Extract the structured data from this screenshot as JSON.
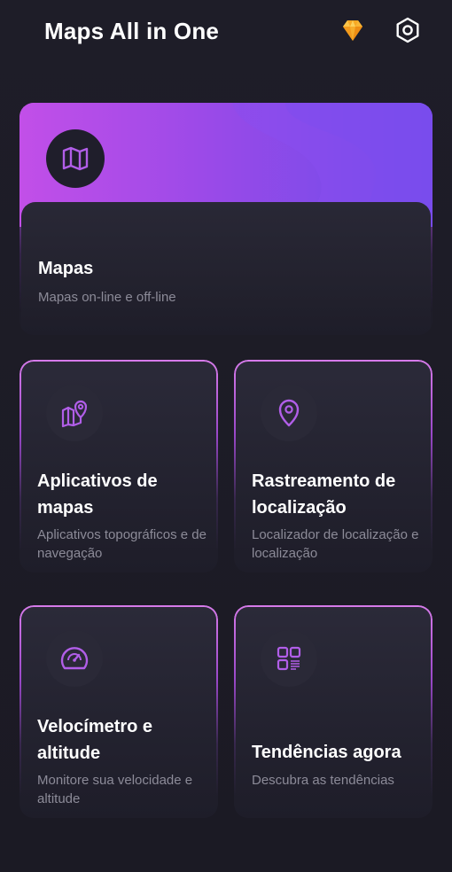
{
  "header": {
    "app_title": "Maps All in One",
    "icons": [
      "diamond-premium-icon",
      "settings-hexagon-icon"
    ]
  },
  "colors": {
    "background": "#1c1b26",
    "accent_purple": "#c24fe8",
    "accent_violet": "#6a4cea",
    "icon_stroke": "#b15ee8",
    "premium_gold": "#f7b028"
  },
  "hero_card": {
    "title": "Mapas",
    "subtitle": "Mapas on-line e off-line",
    "icon": "folded-map-icon"
  },
  "cards": [
    {
      "title": "Aplicativos de mapas",
      "subtitle": "Aplicativos topográficos e de navegação",
      "icon": "map-pin-icon"
    },
    {
      "title": "Rastreamento de localização",
      "subtitle": "Localizador de localização e localização",
      "icon": "location-pin-icon"
    },
    {
      "title": "Velocímetro e altitude",
      "subtitle": "Monitore sua velocidade e altitude",
      "icon": "speedometer-icon"
    },
    {
      "title": "Tendências agora",
      "subtitle": "Descubra as tendências",
      "icon": "trends-grid-icon"
    }
  ]
}
